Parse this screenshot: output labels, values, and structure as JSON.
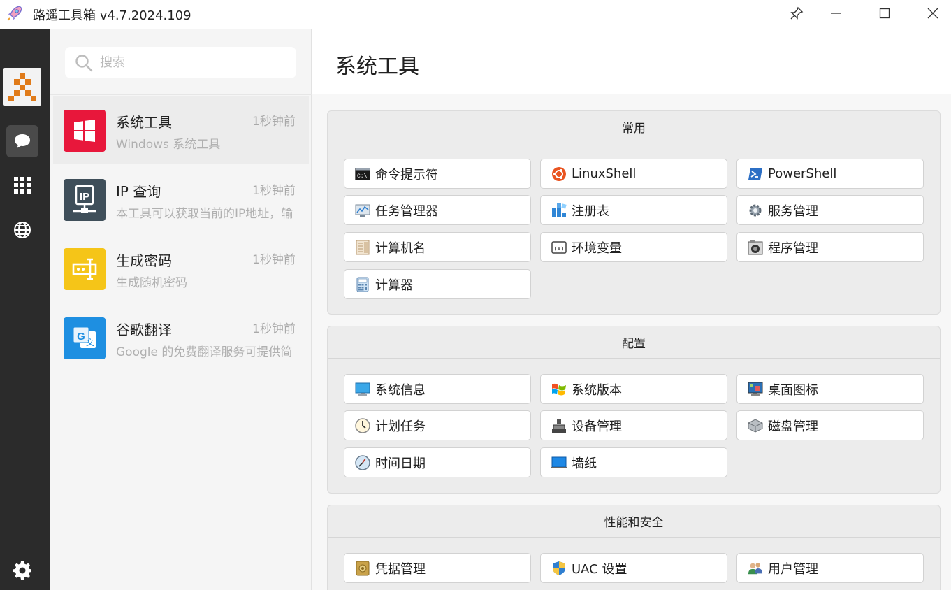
{
  "window": {
    "title": "路遥工具箱 v4.7.2024.109"
  },
  "search": {
    "placeholder": "搜索"
  },
  "list": [
    {
      "name": "系统工具",
      "time": "1秒钟前",
      "desc": "Windows 系统工具",
      "icon": "windows-icon",
      "color": "#e8173b"
    },
    {
      "name": "IP 查询",
      "time": "1秒钟前",
      "desc": "本工具可以获取当前的IP地址，输",
      "icon": "ip-network-icon",
      "color": "#3f4f5a"
    },
    {
      "name": "生成密码",
      "time": "1秒钟前",
      "desc": "生成随机密码",
      "icon": "password-icon",
      "color": "#f5c518"
    },
    {
      "name": "谷歌翻译",
      "time": "1秒钟前",
      "desc": "Google 的免费翻译服务可提供简",
      "icon": "translate-icon",
      "color": "#1e8fe1"
    }
  ],
  "main": {
    "title": "系统工具",
    "groups": [
      {
        "title": "常用",
        "buttons": [
          {
            "label": "命令提示符",
            "icon": "cmd-icon"
          },
          {
            "label": "LinuxShell",
            "icon": "ubuntu-icon"
          },
          {
            "label": "PowerShell",
            "icon": "powershell-icon"
          },
          {
            "label": "任务管理器",
            "icon": "task-manager-icon"
          },
          {
            "label": "注册表",
            "icon": "registry-icon"
          },
          {
            "label": "服务管理",
            "icon": "services-gear-icon"
          },
          {
            "label": "计算机名",
            "icon": "computer-name-icon"
          },
          {
            "label": "环境变量",
            "icon": "env-variable-icon"
          },
          {
            "label": "程序管理",
            "icon": "program-manager-icon"
          },
          {
            "label": "计算器",
            "icon": "calculator-icon"
          }
        ]
      },
      {
        "title": "配置",
        "buttons": [
          {
            "label": "系统信息",
            "icon": "monitor-icon"
          },
          {
            "label": "系统版本",
            "icon": "windows-flag-icon"
          },
          {
            "label": "桌面图标",
            "icon": "desktop-icon"
          },
          {
            "label": "计划任务",
            "icon": "clock-icon"
          },
          {
            "label": "设备管理",
            "icon": "device-manager-icon"
          },
          {
            "label": "磁盘管理",
            "icon": "disk-icon"
          },
          {
            "label": "时间日期",
            "icon": "date-time-icon"
          },
          {
            "label": "墙纸",
            "icon": "wallpaper-icon"
          }
        ]
      },
      {
        "title": "性能和安全",
        "buttons": [
          {
            "label": "凭据管理",
            "icon": "credential-icon"
          },
          {
            "label": "UAC 设置",
            "icon": "uac-shield-icon"
          },
          {
            "label": "用户管理",
            "icon": "users-icon"
          }
        ]
      }
    ]
  }
}
